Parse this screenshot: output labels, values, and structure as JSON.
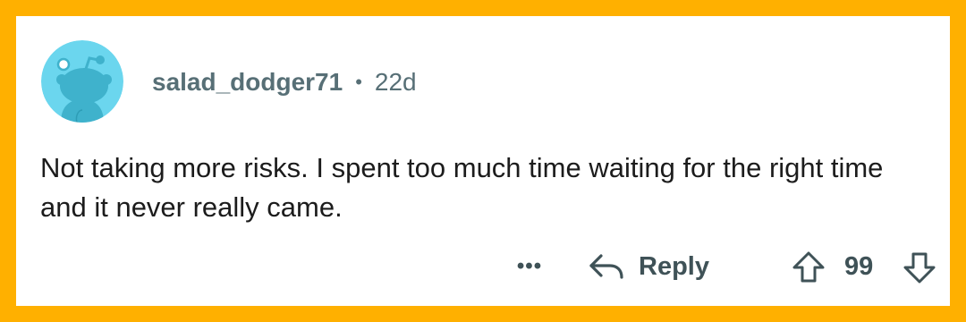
{
  "comment": {
    "username": "salad_dodger71",
    "separator": "•",
    "age": "22d",
    "text": "Not taking more risks. I spent too much time waiting for the right time and it never really came.",
    "avatar": {
      "icon": "snoo-avatar-icon",
      "color": "#6BD6EE"
    }
  },
  "actions": {
    "more_label": "•••",
    "reply_label": "Reply",
    "vote_count": "99"
  },
  "colors": {
    "border": "#FFB000",
    "background": "#FFFFFF",
    "text": "#1C1C1C",
    "meta": "#576F76",
    "action": "#3F5257"
  }
}
